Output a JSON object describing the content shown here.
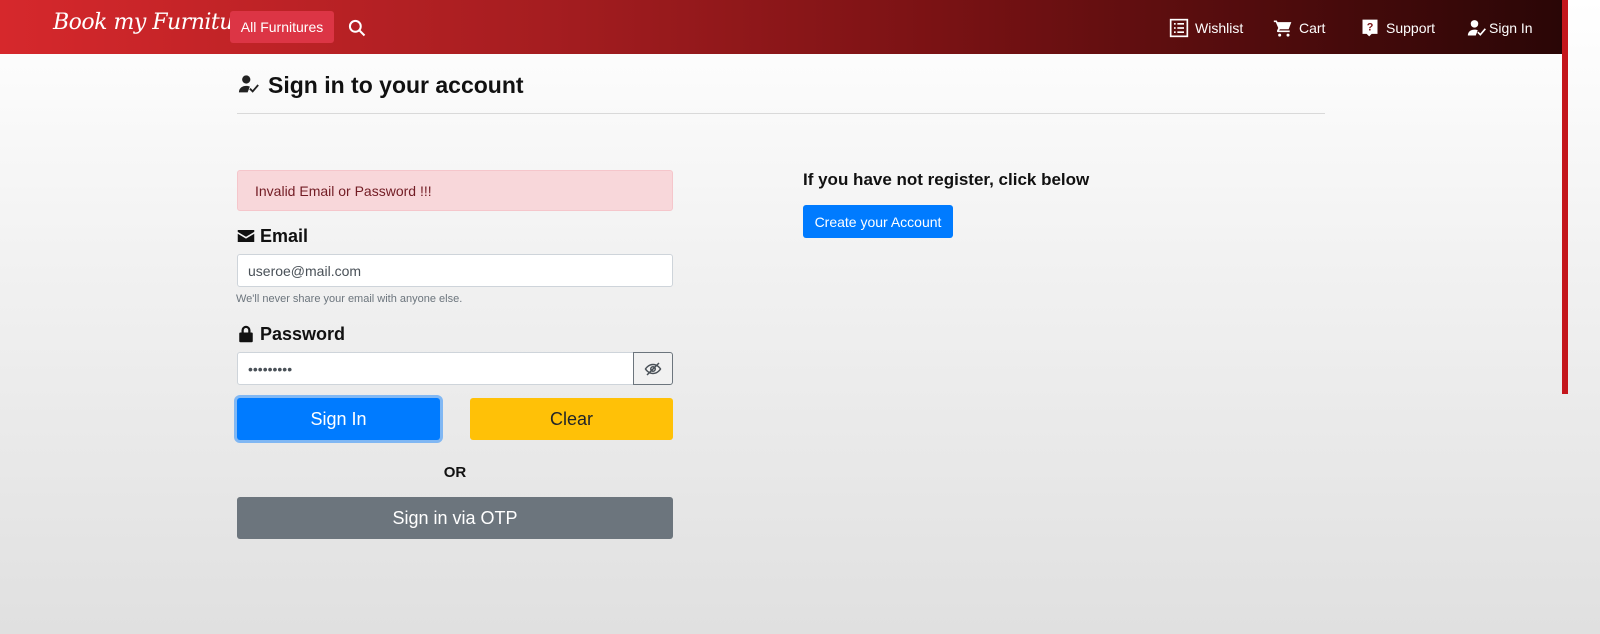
{
  "navbar": {
    "brand": "Book my Furniture",
    "category_button": "All Furnitures",
    "items": [
      {
        "label": "Wishlist",
        "icon": "list-icon"
      },
      {
        "label": "Cart",
        "icon": "cart-icon"
      },
      {
        "label": "Support",
        "icon": "help-icon"
      },
      {
        "label": "Sign In",
        "icon": "user-check-icon"
      }
    ]
  },
  "page": {
    "title": "Sign in to your account"
  },
  "alert": {
    "message": "Invalid Email or Password !!!"
  },
  "form": {
    "email_label": "Email",
    "email_value": "useroe@mail.com",
    "email_help": "We'll never share your email with anyone else.",
    "password_label": "Password",
    "password_value": "•••••••••",
    "signin_label": "Sign In",
    "clear_label": "Clear",
    "or_text": "OR",
    "otp_label": "Sign in via OTP"
  },
  "register": {
    "heading": "If you have not register, click below",
    "button_label": "Create your Account"
  },
  "colors": {
    "primary": "#007bff",
    "warning": "#ffc107",
    "secondary": "#6c757d",
    "danger_bg": "#f8d7da",
    "nav_start": "#d6282c",
    "nav_end": "#2a0606"
  }
}
